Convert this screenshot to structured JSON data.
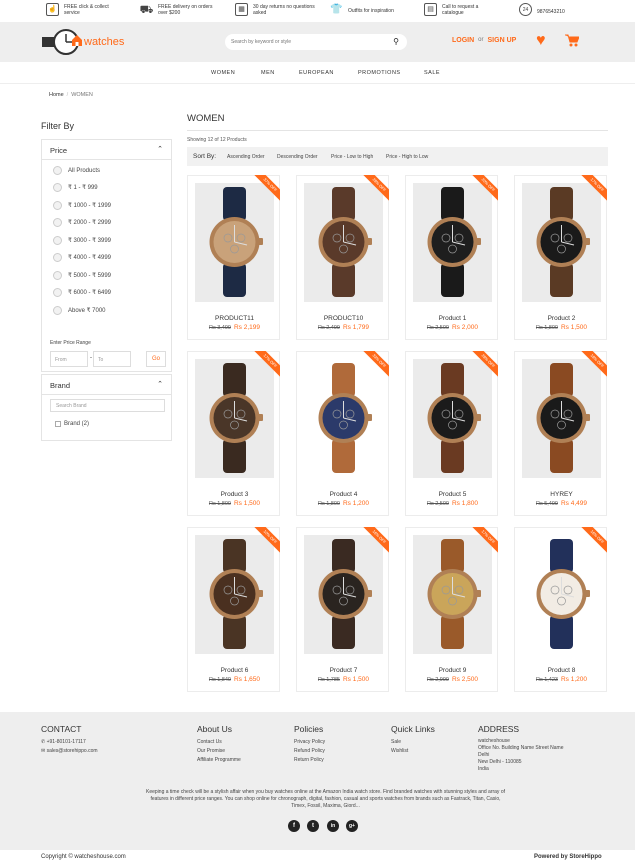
{
  "topstrip": {
    "items": [
      {
        "icon": "hand-click-icon",
        "text": "FREE click & collect service"
      },
      {
        "icon": "truck-icon",
        "text": "FREE delivery on orders over $200"
      },
      {
        "icon": "calendar-icon",
        "text": "30 day returns no questions asked"
      },
      {
        "icon": "shirt-icon",
        "text": "Outfits for inspiration"
      },
      {
        "icon": "catalogue-icon",
        "text": "Call to request a catalogue"
      },
      {
        "icon": "phone-24-icon",
        "text": "9876543210"
      }
    ]
  },
  "header": {
    "logo_text": "watches",
    "search_placeholder": "Search by keyword or style",
    "login": "LOGIN",
    "or": "or",
    "signup": "SIGN UP"
  },
  "nav": [
    "WOMEN",
    "MEN",
    "EUROPEAN",
    "PROMOTIONS",
    "SALE"
  ],
  "breadcrumb": {
    "home": "Home",
    "sep": "/",
    "current": "WOMEN"
  },
  "sidebar": {
    "title": "Filter By",
    "price": {
      "heading": "Price",
      "options": [
        "All Products",
        "₹ 1 - ₹ 999",
        "₹ 1000 - ₹ 1999",
        "₹ 2000 - ₹ 2999",
        "₹ 3000 - ₹ 3999",
        "₹ 4000 - ₹ 4999",
        "₹ 5000 - ₹ 5999",
        "₹ 6000 - ₹ 6499",
        "Above ₹ 7000"
      ],
      "range_label": "Enter Price Range",
      "from_placeholder": "From",
      "to_placeholder": "To",
      "dash": "-",
      "go": "Go"
    },
    "brand": {
      "heading": "Brand",
      "search_placeholder": "Search Brand",
      "options": [
        "Brand (2)"
      ]
    }
  },
  "main": {
    "title": "WOMEN",
    "showing": "Showing 12 of 12 Products",
    "sort_label": "Sort By:",
    "sort_options": [
      "Ascending Order",
      "Descending Order",
      "Price - Low to High",
      "Price - High to Low"
    ]
  },
  "products": [
    {
      "name": "PRODUCT11",
      "old": "Rs 3,499",
      "new": "Rs 2,199",
      "discount": "37% OFF"
    },
    {
      "name": "PRODUCT10",
      "old": "Rs 2,499",
      "new": "Rs 1,799",
      "discount": "28% OFF"
    },
    {
      "name": "Product 1",
      "old": "Rs 2,500",
      "new": "Rs 2,000",
      "discount": "20% OFF"
    },
    {
      "name": "Product 2",
      "old": "Rs 1,800",
      "new": "Rs 1,500",
      "discount": "17% OFF"
    },
    {
      "name": "Product 3",
      "old": "Rs 1,800",
      "new": "Rs 1,500",
      "discount": "17% OFF"
    },
    {
      "name": "Product 4",
      "old": "Rs 1,800",
      "new": "Rs 1,200",
      "discount": "33% OFF"
    },
    {
      "name": "Product 5",
      "old": "Rs 2,500",
      "new": "Rs 1,800",
      "discount": "28% OFF"
    },
    {
      "name": "HYREY",
      "old": "Rs 5,499",
      "new": "Rs 4,499",
      "discount": "18% OFF"
    },
    {
      "name": "Product 6",
      "old": "Rs 1,840",
      "new": "Rs 1,650",
      "discount": "10% OFF"
    },
    {
      "name": "Product 7",
      "old": "Rs 1,785",
      "new": "Rs 1,500",
      "discount": "16% OFF"
    },
    {
      "name": "Product 9",
      "old": "Rs 2,999",
      "new": "Rs 2,500",
      "discount": "17% OFF"
    },
    {
      "name": "Product 8",
      "old": "Rs 1,423",
      "new": "Rs 1,200",
      "discount": "16% OFF"
    }
  ],
  "footer": {
    "contact": {
      "heading": "CONTACT",
      "phone": "+91-80101-17117",
      "email": "sales@storehippo.com"
    },
    "about": {
      "heading": "About Us",
      "links": [
        "Contact Us",
        "Our Promise",
        "Affiliate Programme"
      ]
    },
    "policies": {
      "heading": "Policies",
      "links": [
        "Privacy Policy",
        "Refund Policy",
        "Return Policy"
      ]
    },
    "quick": {
      "heading": "Quick Links",
      "links": [
        "Sale",
        "Wishlist"
      ]
    },
    "address": {
      "heading": "ADDRESS",
      "lines": [
        "watcheshouse",
        "Office No. Building Name Street Name",
        "Delhi",
        "New Delhi - 110085",
        "India"
      ]
    },
    "description": "Keeping a time check will be a stylish affair when you buy watches online at the Amazon India watch store. Find branded watches with stunning styles and array of features in different price ranges. You can shop online for chronograph, digital, fashion, casual and sports watches from brands such as Fastrack, Titan, Casio, Timex, Fossil, Maxima, Giord...",
    "social": [
      "f",
      "t",
      "in",
      "g+"
    ],
    "copyright": "Copyright © watcheshouse.com",
    "powered": "Powered by StoreHippo"
  },
  "colors": {
    "accent": "#ff6a1a",
    "band": "#eeeeee"
  }
}
